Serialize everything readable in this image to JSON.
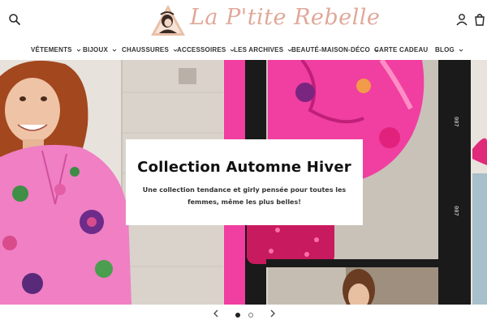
{
  "brand": {
    "name": "La P'tite Rebelle",
    "accent_color": "#e0a899"
  },
  "header_icons": [
    "search-icon",
    "account-icon",
    "cart-icon"
  ],
  "nav": {
    "items": [
      {
        "label": "VÊTEMENTS",
        "has_dropdown": true
      },
      {
        "label": "BIJOUX",
        "has_dropdown": true
      },
      {
        "label": "CHAUSSURES",
        "has_dropdown": true
      },
      {
        "label": "ACCESSOIRES",
        "has_dropdown": true
      },
      {
        "label": "LES ARCHIVES",
        "has_dropdown": true
      },
      {
        "label": "BEAUTÉ-MAISON-DÉCO",
        "has_dropdown": true
      },
      {
        "label": "CARTE CADEAU",
        "has_dropdown": false
      },
      {
        "label": "BLOG",
        "has_dropdown": true
      }
    ]
  },
  "hero": {
    "title": "Collection Automne Hiver",
    "subtitle": "Une collection tendance et girly pensée pour toutes les femmes, même les plus belles!",
    "colors": {
      "pink": "#f03fa0",
      "film": "#1a1a1a"
    }
  },
  "slider": {
    "prev_icon": "chevron-left-icon",
    "next_icon": "chevron-right-icon",
    "slide_count": 2,
    "active_slide": 1
  }
}
